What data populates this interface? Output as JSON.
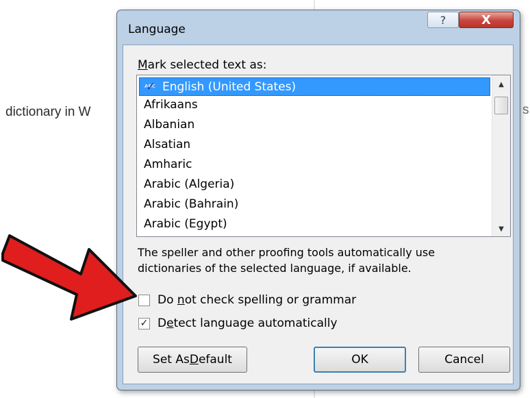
{
  "background": {
    "text": "dictionary in W",
    "right_char": "s"
  },
  "dialog": {
    "title": "Language",
    "help_label": "?",
    "close_label": "X",
    "mark_label_pre": "M",
    "mark_label_rest": "ark selected text as:",
    "languages": [
      "English (United States)",
      "Afrikaans",
      "Albanian",
      "Alsatian",
      "Amharic",
      "Arabic (Algeria)",
      "Arabic (Bahrain)",
      "Arabic (Egypt)"
    ],
    "selected_language": "English (United States)",
    "description": "The speller and other proofing tools automatically use dictionaries of the selected language, if available.",
    "no_check": {
      "pre": "Do ",
      "ul": "n",
      "post": "ot check spelling or grammar",
      "checked": false
    },
    "detect": {
      "pre": "D",
      "ul": "e",
      "post": "tect language automatically",
      "checked": true
    },
    "buttons": {
      "set_default_pre": "Set As ",
      "set_default_ul": "D",
      "set_default_post": "efault",
      "ok": "OK",
      "cancel": "Cancel"
    }
  },
  "icons": {
    "spell": "spellcheck-abc-icon",
    "arrow": "red-pointer-arrow"
  },
  "colors": {
    "selection": "#3399ff",
    "dialog_frame": "#bcd0e6",
    "close_button": "#c7443a",
    "arrow": "#e01e1e"
  }
}
